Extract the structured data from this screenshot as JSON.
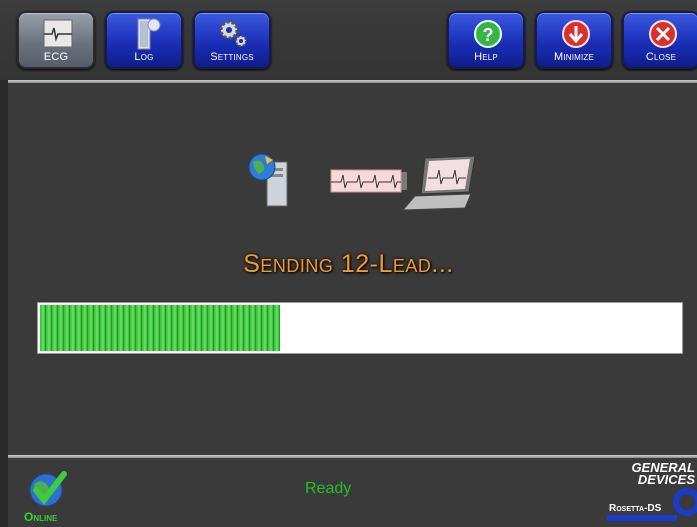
{
  "toolbar": {
    "buttons": [
      {
        "label": "ECG",
        "icon": "ecg-icon"
      },
      {
        "label": "Log",
        "icon": "log-icon"
      },
      {
        "label": "Settings",
        "icon": "gear-icon"
      },
      {
        "label": "Help",
        "icon": "help-icon"
      },
      {
        "label": "Minimize",
        "icon": "minimize-icon"
      },
      {
        "label": "Close",
        "icon": "close-icon"
      }
    ]
  },
  "main": {
    "title": "Sending 12-Lead...",
    "progress_fraction": 0.375
  },
  "status": {
    "text": "Ready",
    "connection": "Online"
  },
  "brand": {
    "line1": "GENERAL",
    "line2": "DEVICES",
    "product": "Rosetta-DS"
  },
  "colors": {
    "title": "#f29a2e",
    "progress": "#2fbf2f",
    "status": "#23c023",
    "button": "#1a2fb8"
  }
}
